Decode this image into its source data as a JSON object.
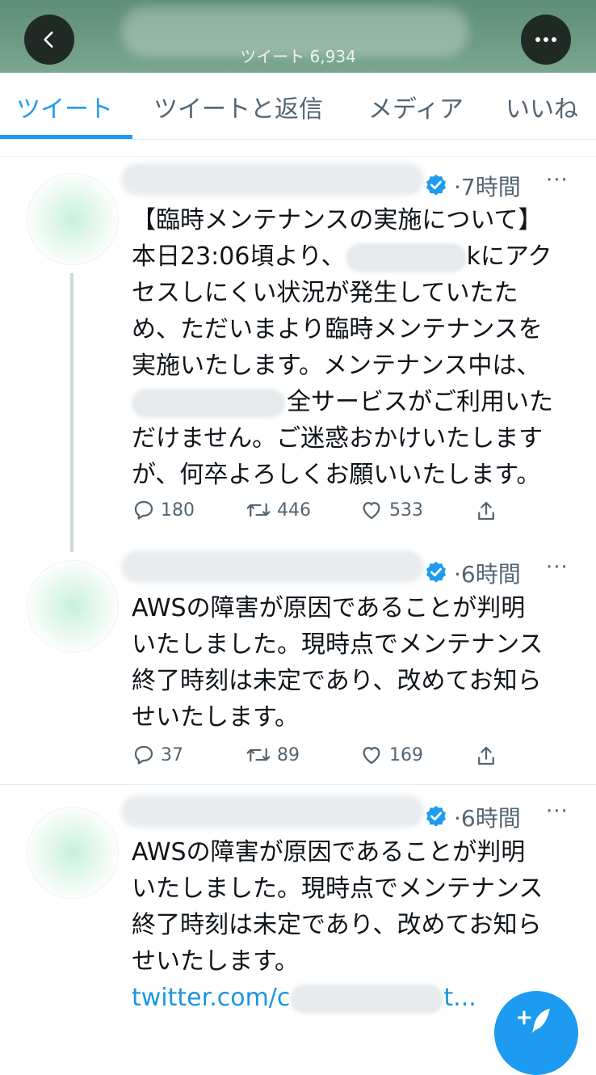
{
  "header": {
    "tweet_count": "ツイート 6,934"
  },
  "tabs": [
    {
      "label": "ツイート",
      "active": true
    },
    {
      "label": "ツイートと返信",
      "active": false
    },
    {
      "label": "メディア",
      "active": false
    },
    {
      "label": "いいね",
      "active": false
    }
  ],
  "tweets": [
    {
      "time": "7時間",
      "lines": [
        "【臨時メンテナンスの実施について】",
        {
          "before": "本日23:06頃より、",
          "after": "kにアク"
        },
        "セスしにくい状況が発生していたた",
        "め、ただいまより臨時メンテナンスを",
        "実施いたします。メンテナンス中は、",
        {
          "before": "",
          "after": "全サービスがご利用いた"
        },
        "だけません。ご迷惑おかけいたします",
        "が、何卒よろしくお願いいたします。"
      ],
      "replies": "180",
      "retweets": "446",
      "likes": "533"
    },
    {
      "time": "6時間",
      "lines": [
        "AWSの障害が原因であることが判明",
        "いたしました。現時点でメンテナンス",
        "終了時刻は未定であり、改めてお知ら",
        "せいたします。"
      ],
      "replies": "37",
      "retweets": "89",
      "likes": "169"
    },
    {
      "time": "6時間",
      "lines": [
        "AWSの障害が原因であることが判明",
        "いたしました。現時点でメンテナンス",
        "終了時刻は未定であり、改めてお知ら",
        "せいたします。"
      ],
      "link_before": "twitter.com/c",
      "link_after": "t..."
    }
  ],
  "colors": {
    "accent": "#1d9bf0",
    "muted": "#536471",
    "header_bg": "#6d9a83"
  },
  "icons": [
    "back-icon",
    "more-icon",
    "verified-icon",
    "reply-icon",
    "retweet-icon",
    "like-icon",
    "share-icon",
    "compose-icon"
  ]
}
